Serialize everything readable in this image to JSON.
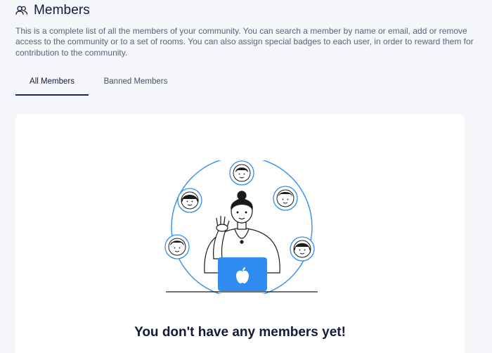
{
  "header": {
    "icon": "members-icon",
    "title": "Members"
  },
  "description": "This is a complete list of all the members of your community. You can search a member by name or email, add or remove access to the community or to a set of rooms. You can also assign special badges to each user, in order to reward them for contribution to the community.",
  "tabs": [
    {
      "label": "All Members",
      "active": true
    },
    {
      "label": "Banned Members",
      "active": false
    }
  ],
  "empty_state": {
    "illustration": "person-waving-laptop-illustration",
    "title": "You don't have any members yet!"
  },
  "colors": {
    "accent": "#2f8df2",
    "tab_underline": "#1c2356",
    "background": "#f4f6fa"
  }
}
